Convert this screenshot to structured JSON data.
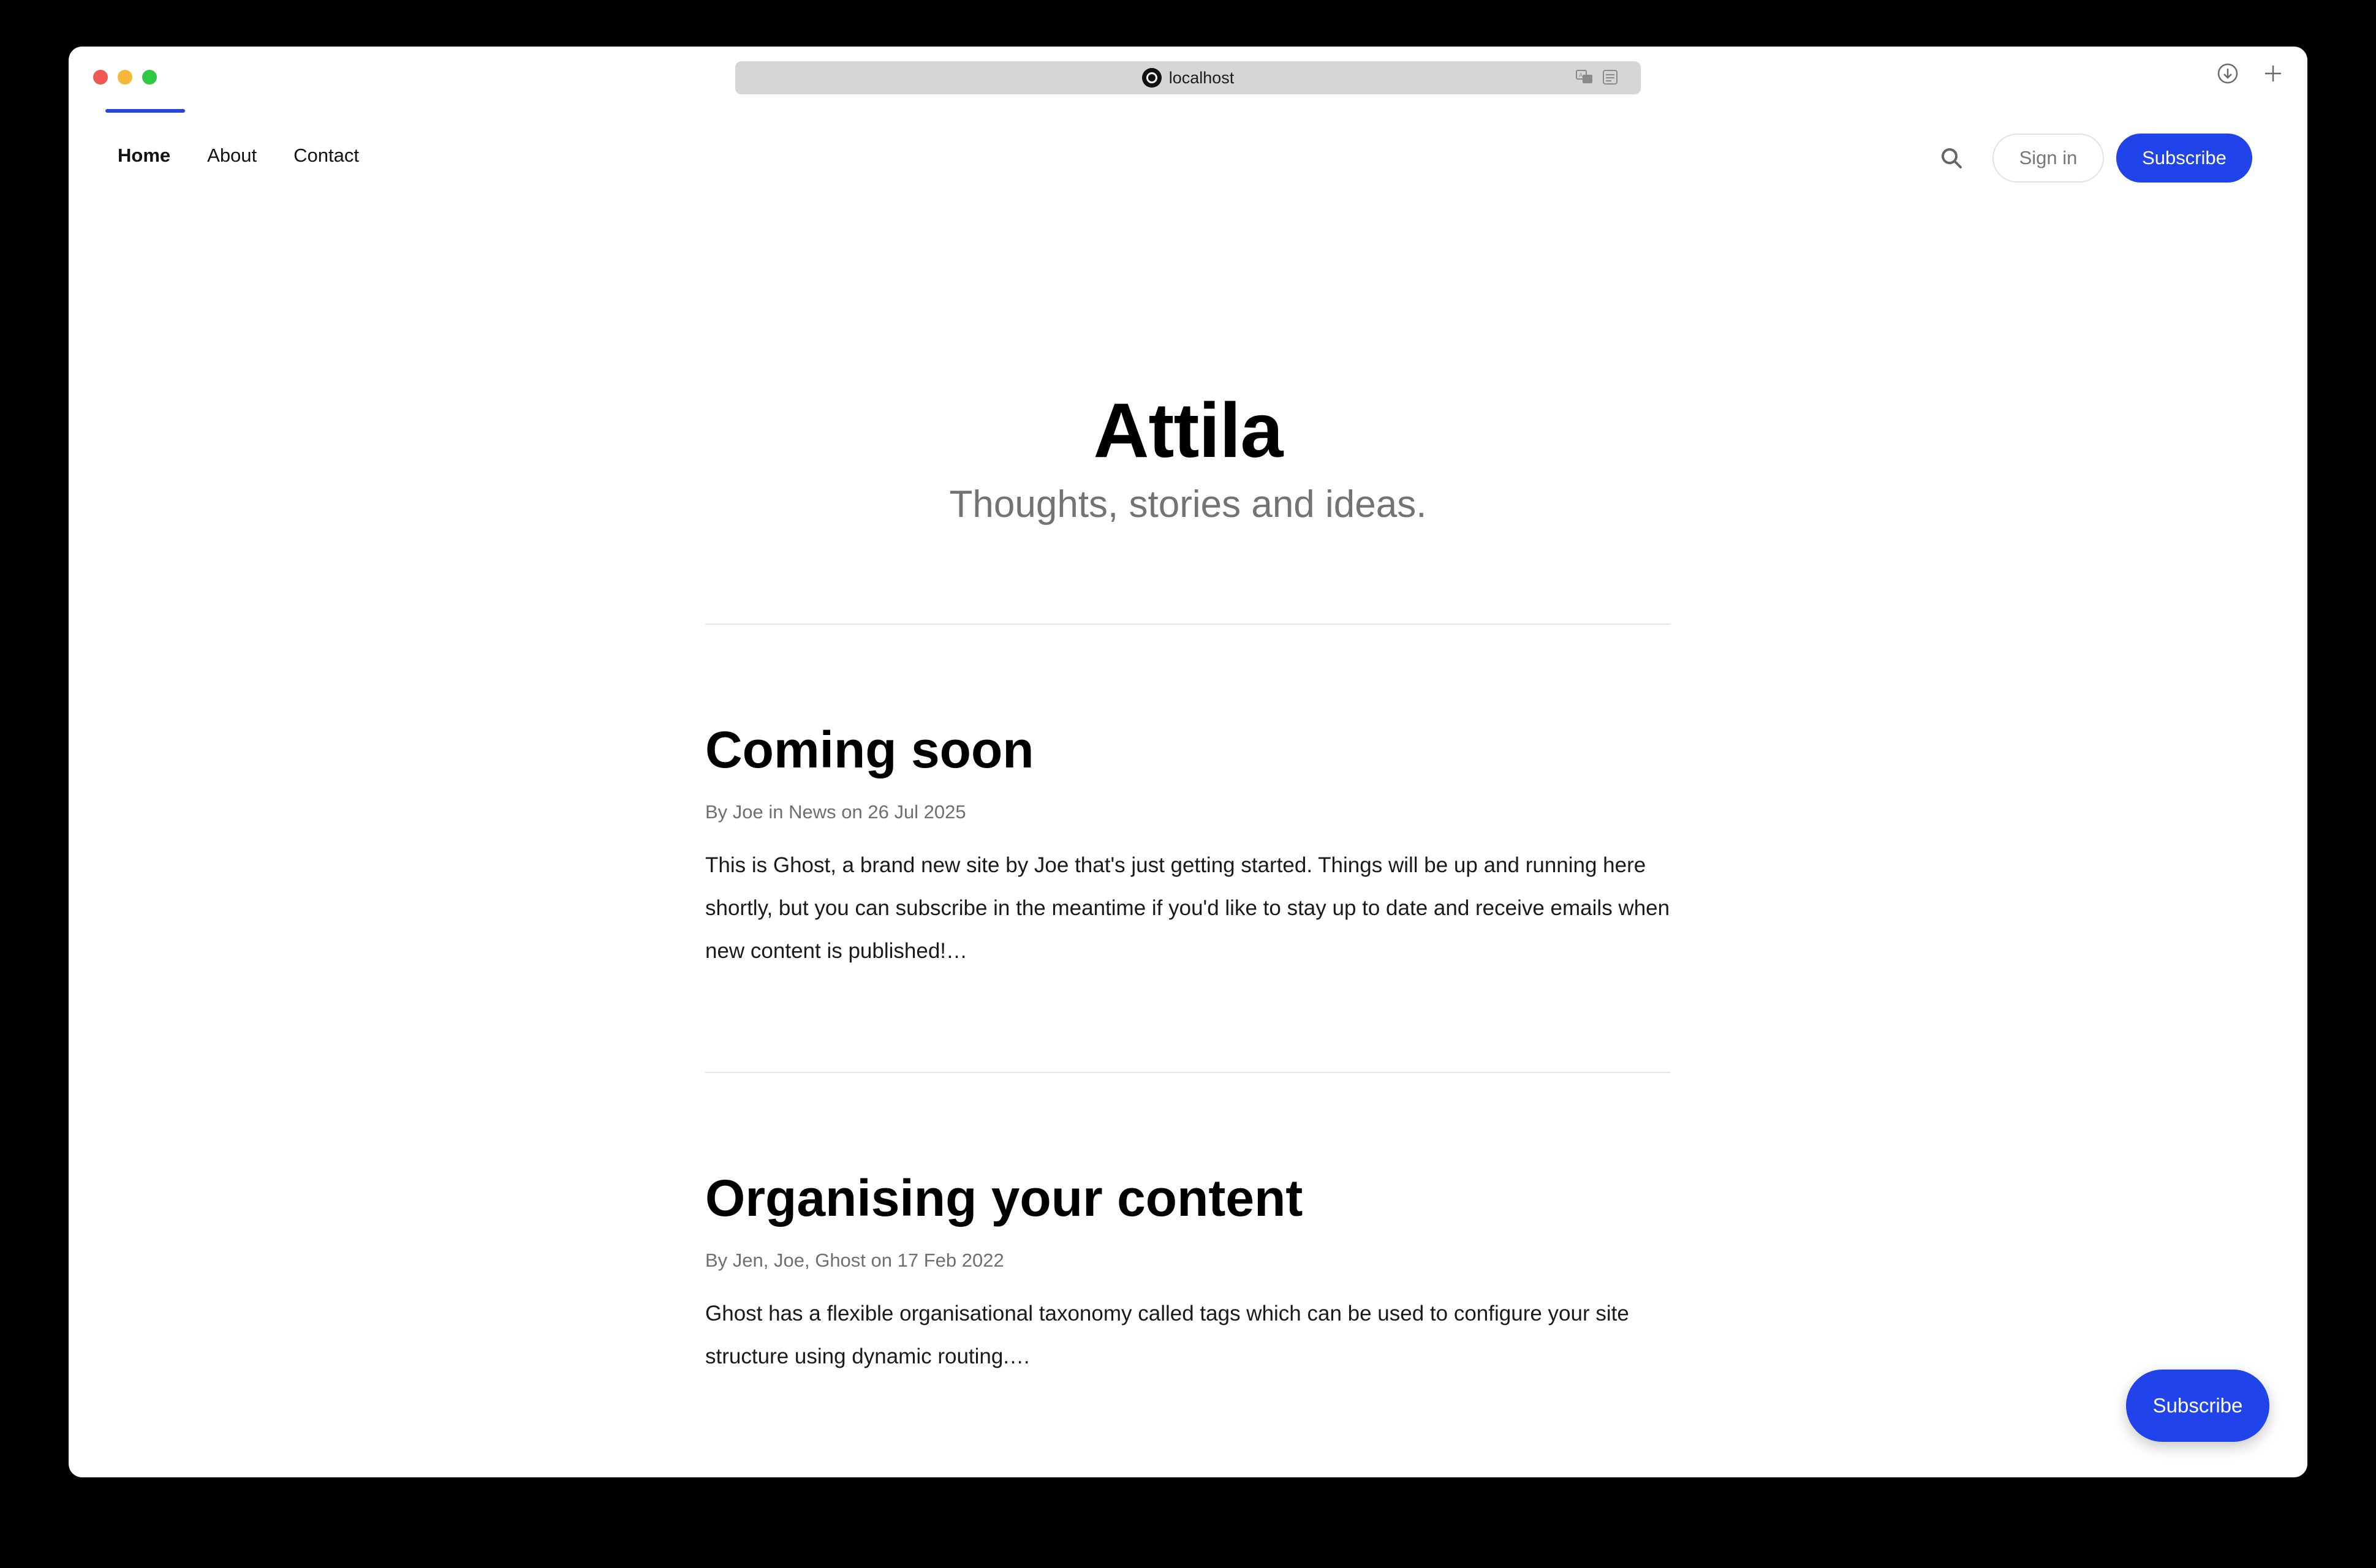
{
  "browser": {
    "url": "localhost",
    "icons": [
      "site-icon",
      "translate-icon",
      "reader-icon",
      "download-icon",
      "new-tab-icon"
    ]
  },
  "nav": {
    "items": [
      {
        "label": "Home",
        "active": true
      },
      {
        "label": "About",
        "active": false
      },
      {
        "label": "Contact",
        "active": false
      }
    ],
    "search_icon": "search-icon",
    "signin_label": "Sign in",
    "subscribe_label": "Subscribe"
  },
  "hero": {
    "title": "Attila",
    "subtitle": "Thoughts, stories and ideas."
  },
  "posts": [
    {
      "title": "Coming soon",
      "meta": "By Joe in News on 26 Jul 2025",
      "excerpt": "This is Ghost, a brand new site by Joe that's just getting started. Things will be up and running here shortly, but you can subscribe in the meantime if you'd like to stay up to date and receive emails when new content is published!…"
    },
    {
      "title": "Organising your content",
      "meta": "By Jen, Joe, Ghost on 17 Feb 2022",
      "excerpt": "Ghost has a flexible organisational taxonomy called tags which can be used to configure your site structure using dynamic routing.…"
    }
  ],
  "floating": {
    "subscribe_label": "Subscribe"
  },
  "colors": {
    "accent": "#2043ea",
    "muted_text": "#737373",
    "divider": "#e6e6e6"
  }
}
